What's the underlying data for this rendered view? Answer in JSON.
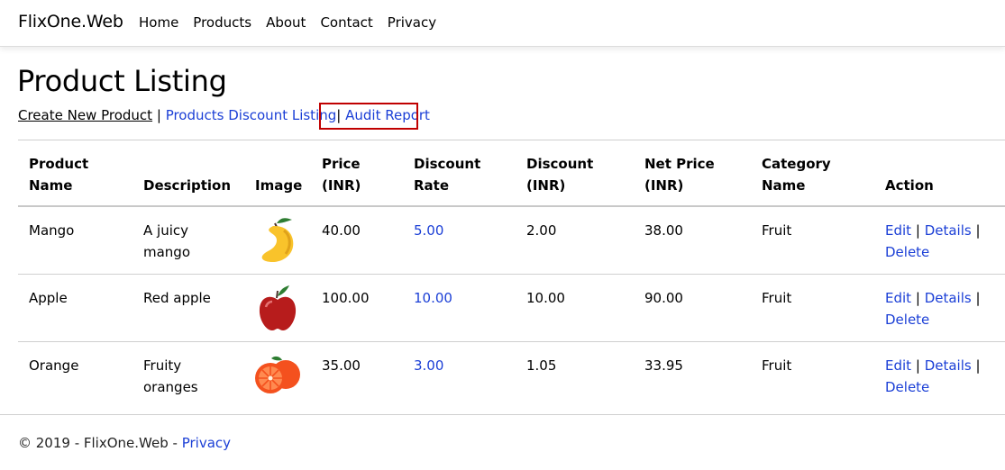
{
  "nav": {
    "brand": "FlixOne.Web",
    "items": [
      "Home",
      "Products",
      "About",
      "Contact",
      "Privacy"
    ]
  },
  "page": {
    "title": "Product Listing",
    "links": {
      "create": "Create New Product",
      "sep1": "|",
      "discount": "Products Discount Listing",
      "sep2": "|",
      "audit": "Audit Report"
    }
  },
  "table": {
    "headers": {
      "product": [
        "Product",
        "Name"
      ],
      "description": "Description",
      "image": "Image",
      "price": [
        "Price",
        "(INR)"
      ],
      "rate": [
        "Discount",
        "Rate"
      ],
      "discount": [
        "Discount",
        "(INR)"
      ],
      "net": [
        "Net Price",
        "(INR)"
      ],
      "category": [
        "Category",
        "Name"
      ],
      "action": "Action"
    },
    "rows": [
      {
        "name": "Mango",
        "desc": [
          "A juicy",
          "mango"
        ],
        "image": "mango-icon",
        "price": "40.00",
        "rate": "5.00",
        "discount": "2.00",
        "net": "38.00",
        "category": "Fruit"
      },
      {
        "name": "Apple",
        "desc": [
          "Red apple"
        ],
        "image": "apple-icon",
        "price": "100.00",
        "rate": "10.00",
        "discount": "10.00",
        "net": "90.00",
        "category": "Fruit"
      },
      {
        "name": "Orange",
        "desc": [
          "Fruity",
          "oranges"
        ],
        "image": "orange-icon",
        "price": "35.00",
        "rate": "3.00",
        "discount": "1.05",
        "net": "33.95",
        "category": "Fruit"
      }
    ],
    "actions": {
      "edit": "Edit",
      "sep": "|",
      "details": "Details",
      "delete": "Delete"
    }
  },
  "footer": {
    "text": "© 2019 - FlixOne.Web - ",
    "privacy": "Privacy"
  },
  "colors": {
    "link": "#1b3fd6",
    "highlight_box": "#c00000"
  }
}
